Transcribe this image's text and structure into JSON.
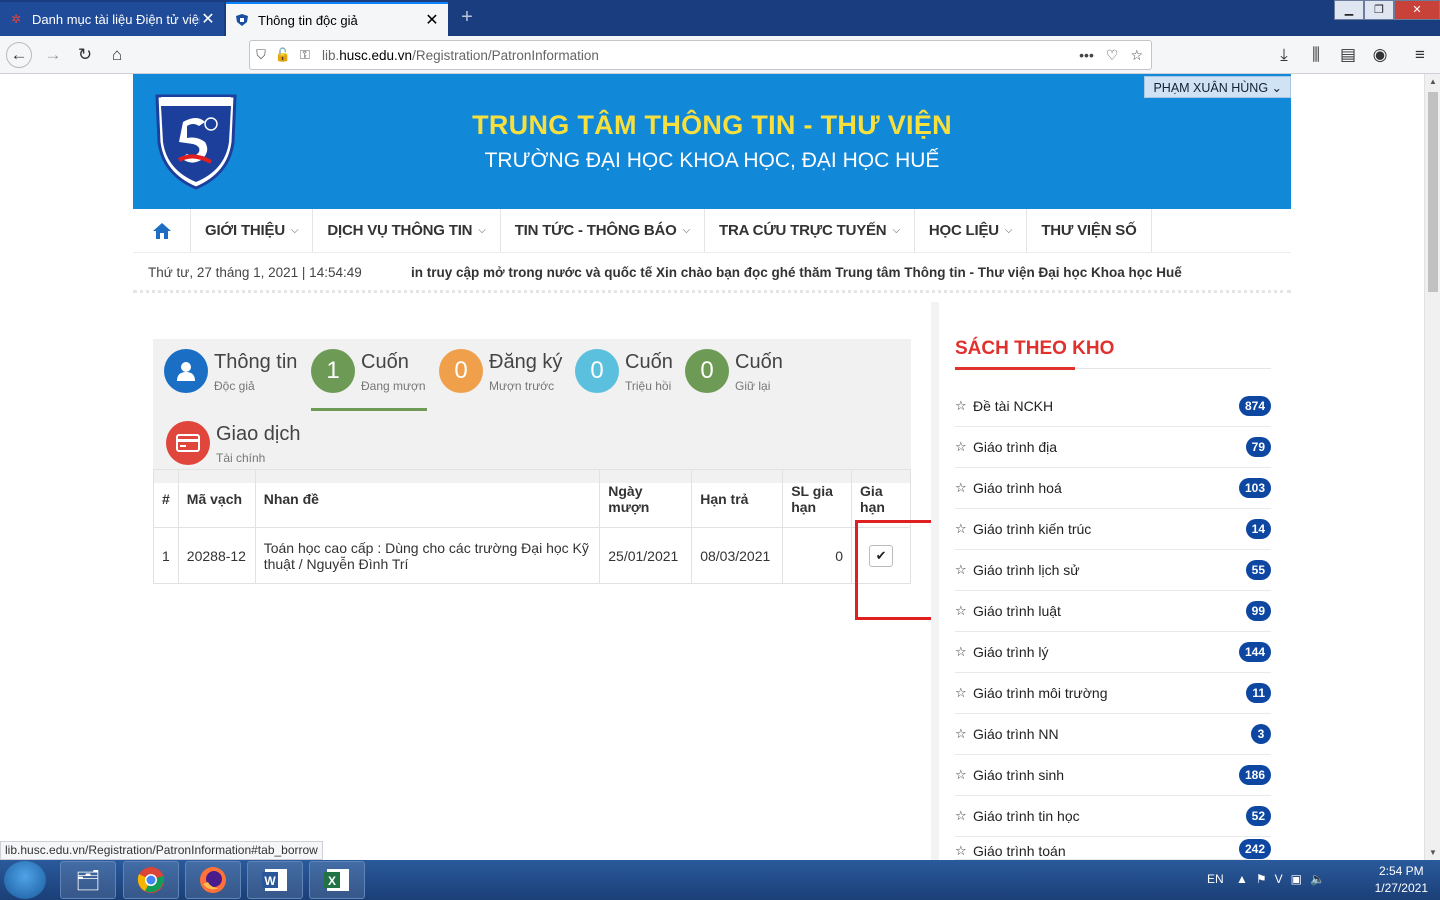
{
  "browser": {
    "tabs": [
      {
        "title": "Danh mục tài liệu Điện tử viện",
        "active": false
      },
      {
        "title": "Thông tin độc giả",
        "active": true
      }
    ],
    "url_prefix": "lib.",
    "url_domain": "husc.edu.vn",
    "url_path": "/Registration/PatronInformation",
    "status_url": "lib.husc.edu.vn/Registration/PatronInformation#tab_borrow"
  },
  "header": {
    "title": "TRUNG TÂM THÔNG TIN - THƯ VIỆN",
    "subtitle": "TRƯỜNG ĐẠI HỌC KHOA HỌC, ĐẠI HỌC HUẾ",
    "user": "PHẠM XUÂN HÙNG ⌄"
  },
  "menu": [
    {
      "label": "GIỚI THIỆU"
    },
    {
      "label": "DỊCH VỤ THÔNG TIN"
    },
    {
      "label": "TIN TỨC - THÔNG BÁO"
    },
    {
      "label": "TRA CỨU TRỰC TUYẾN"
    },
    {
      "label": "HỌC LIỆU"
    },
    {
      "label": "THƯ VIỆN SỐ"
    }
  ],
  "ticker": {
    "date": "Thứ tư, 27 tháng 1, 2021 | 14:54:49",
    "news": "in truy cập mở trong nước và quốc tế Xin chào bạn đọc ghé thăm Trung tâm Thông tin - Thư viện Đại học Khoa học Huế"
  },
  "summary": [
    {
      "icon": "user-icon",
      "value": "",
      "title": "Thông tin",
      "sub": "Độc giả",
      "color": "#1a6fc4"
    },
    {
      "icon": "",
      "value": "1",
      "title": "Cuốn",
      "sub": "Đang mượn",
      "color": "#6d9a55"
    },
    {
      "icon": "",
      "value": "0",
      "title": "Đăng ký",
      "sub": "Mượn trước",
      "color": "#f0a04b"
    },
    {
      "icon": "",
      "value": "0",
      "title": "Cuốn",
      "sub": "Triệu hồi",
      "color": "#5bc0de"
    },
    {
      "icon": "",
      "value": "0",
      "title": "Cuốn",
      "sub": "Giữ lại",
      "color": "#6d9a55"
    },
    {
      "icon": "credit-card-icon",
      "value": "",
      "title": "Giao dịch",
      "sub": "Tài chính",
      "color": "#e0463c"
    }
  ],
  "table": {
    "headers": [
      "#",
      "Mã vạch",
      "Nhan đề",
      "Ngày mượn",
      "Hạn trả",
      "SL gia hạn",
      "Gia hạn"
    ],
    "rows": [
      {
        "no": "1",
        "barcode": "20288-12",
        "title": "Toán học cao cấp : Dùng cho các trường Đại học Kỹ thuật / Nguyễn Đình Trí",
        "borrowed": "25/01/2021",
        "due": "08/03/2021",
        "renewals": "0"
      }
    ]
  },
  "sidebar": {
    "title": "SÁCH THEO KHO",
    "items": [
      {
        "label": "Đề tài NCKH",
        "count": "874"
      },
      {
        "label": "Giáo trình địa",
        "count": "79"
      },
      {
        "label": "Giáo trình hoá",
        "count": "103"
      },
      {
        "label": "Giáo trình kiến trúc",
        "count": "14"
      },
      {
        "label": "Giáo trình lịch sử",
        "count": "55"
      },
      {
        "label": "Giáo trình luật",
        "count": "99"
      },
      {
        "label": "Giáo trình lý",
        "count": "144"
      },
      {
        "label": "Giáo trình môi trường",
        "count": "11"
      },
      {
        "label": "Giáo trình NN",
        "count": "3"
      },
      {
        "label": "Giáo trình sinh",
        "count": "186"
      },
      {
        "label": "Giáo trình tin học",
        "count": "52"
      },
      {
        "label": "Giáo trình toán",
        "count": "242"
      }
    ]
  },
  "taskbar": {
    "lang": "EN",
    "time": "2:54 PM",
    "date": "1/27/2021"
  }
}
